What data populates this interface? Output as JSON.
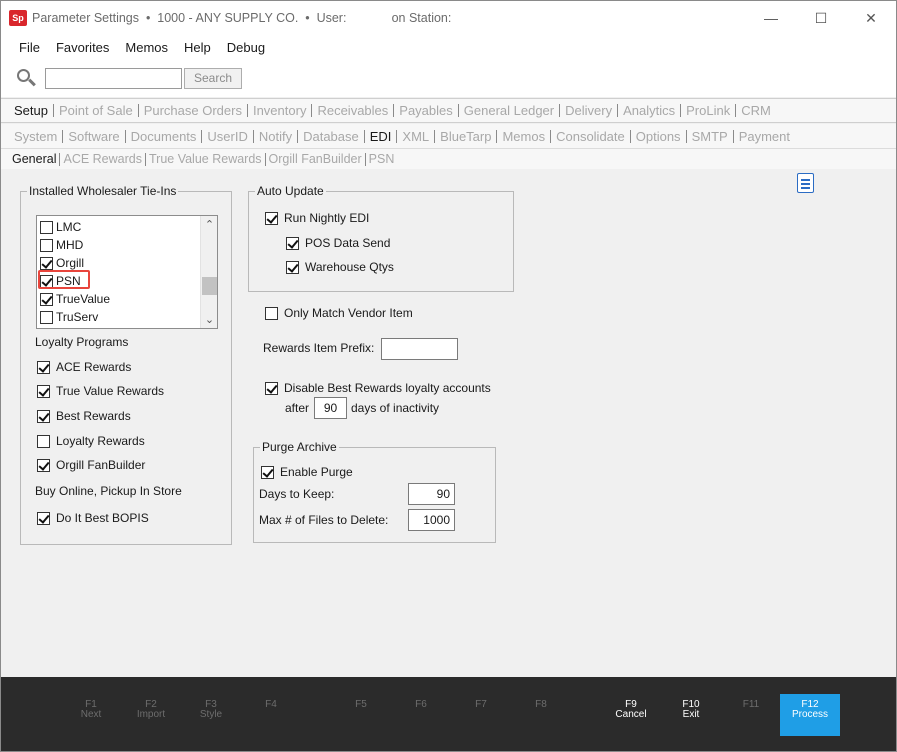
{
  "window": {
    "title": "Parameter Settings  •  1000 - ANY SUPPLY CO.  •  User:             on Station:",
    "logo_text": "Sp",
    "minimize": "—",
    "maximize": "☐",
    "close": "✕"
  },
  "menu": [
    "File",
    "Favorites",
    "Memos",
    "Help",
    "Debug"
  ],
  "search": {
    "value": "",
    "button_label": "Search"
  },
  "tabs_main": [
    {
      "label": "Setup",
      "active": true
    },
    {
      "label": "Point of Sale"
    },
    {
      "label": "Purchase Orders"
    },
    {
      "label": "Inventory"
    },
    {
      "label": "Receivables"
    },
    {
      "label": "Payables"
    },
    {
      "label": "General Ledger"
    },
    {
      "label": "Delivery"
    },
    {
      "label": "Analytics"
    },
    {
      "label": "ProLink"
    },
    {
      "label": "CRM"
    }
  ],
  "tabs_setup": [
    {
      "label": "System"
    },
    {
      "label": "Software"
    },
    {
      "label": "Documents"
    },
    {
      "label": "UserID"
    },
    {
      "label": "Notify"
    },
    {
      "label": "Database"
    },
    {
      "label": "EDI",
      "active": true
    },
    {
      "label": "XML"
    },
    {
      "label": "BlueTarp"
    },
    {
      "label": "Memos"
    },
    {
      "label": "Consolidate"
    },
    {
      "label": "Options"
    },
    {
      "label": "SMTP"
    },
    {
      "label": "Payment"
    }
  ],
  "tabs_edi": [
    {
      "label": "General",
      "active": true
    },
    {
      "label": "ACE Rewards"
    },
    {
      "label": "True Value Rewards"
    },
    {
      "label": "Orgill FanBuilder"
    },
    {
      "label": "PSN"
    }
  ],
  "wholesaler": {
    "legend": "Installed Wholesaler Tie-Ins",
    "items": [
      {
        "label": "LMC",
        "checked": false
      },
      {
        "label": "MHD",
        "checked": false
      },
      {
        "label": "Orgill",
        "checked": true
      },
      {
        "label": "PSN",
        "checked": true
      },
      {
        "label": "TrueValue",
        "checked": true
      },
      {
        "label": "TruServ",
        "checked": false
      }
    ],
    "scroll_up": "⌃",
    "scroll_down": "⌄"
  },
  "loyalty": {
    "heading": "Loyalty Programs",
    "items": [
      {
        "label": "ACE Rewards",
        "checked": true
      },
      {
        "label": "True Value Rewards",
        "checked": true
      },
      {
        "label": "Best Rewards",
        "checked": true
      },
      {
        "label": "Loyalty Rewards",
        "checked": false
      },
      {
        "label": "Orgill FanBuilder",
        "checked": true
      }
    ]
  },
  "bopis": {
    "heading": "Buy Online, Pickup In Store",
    "items": [
      {
        "label": "Do It Best BOPIS",
        "checked": true
      }
    ]
  },
  "auto_update": {
    "legend": "Auto Update",
    "run_nightly": {
      "label": "Run Nightly EDI",
      "checked": true
    },
    "pos_data_send": {
      "label": "POS Data Send",
      "checked": true
    },
    "warehouse_qtys": {
      "label": "Warehouse Qtys",
      "checked": true
    }
  },
  "vendor": {
    "only_match": {
      "label": "Only Match Vendor Item",
      "checked": false
    },
    "rewards_prefix_label": "Rewards Item Prefix:",
    "rewards_prefix_value": "",
    "disable_best": {
      "label": "Disable Best Rewards loyalty accounts",
      "checked": true
    },
    "after_label": "after",
    "after_value": "90",
    "days_label": "days of inactivity"
  },
  "purge": {
    "legend": "Purge Archive",
    "enable": {
      "label": "Enable Purge",
      "checked": true
    },
    "days_label": "Days to Keep:",
    "days_value": "90",
    "max_files_label": "Max # of Files to Delete:",
    "max_files_value": "1000"
  },
  "fkeys": [
    {
      "key": "F1",
      "label": "Next",
      "state": "disabled"
    },
    {
      "key": "F2",
      "label": "Import",
      "state": "disabled"
    },
    {
      "key": "F3",
      "label": "Style",
      "state": "disabled"
    },
    {
      "key": "F4",
      "label": "",
      "state": "disabled"
    },
    {
      "key": "F5",
      "label": "",
      "state": "disabled"
    },
    {
      "key": "F6",
      "label": "",
      "state": "disabled"
    },
    {
      "key": "F7",
      "label": "",
      "state": "disabled"
    },
    {
      "key": "F8",
      "label": "",
      "state": "disabled"
    },
    {
      "key": "F9",
      "label": "Cancel",
      "state": "enabled"
    },
    {
      "key": "F10",
      "label": "Exit",
      "state": "enabled"
    },
    {
      "key": "F11",
      "label": "",
      "state": "disabled"
    },
    {
      "key": "F12",
      "label": "Process",
      "state": "primary"
    }
  ],
  "colors": {
    "accent": "#1f9ee6",
    "highlight": "#e8453c",
    "fkey_bar": "#2b2b2b"
  }
}
